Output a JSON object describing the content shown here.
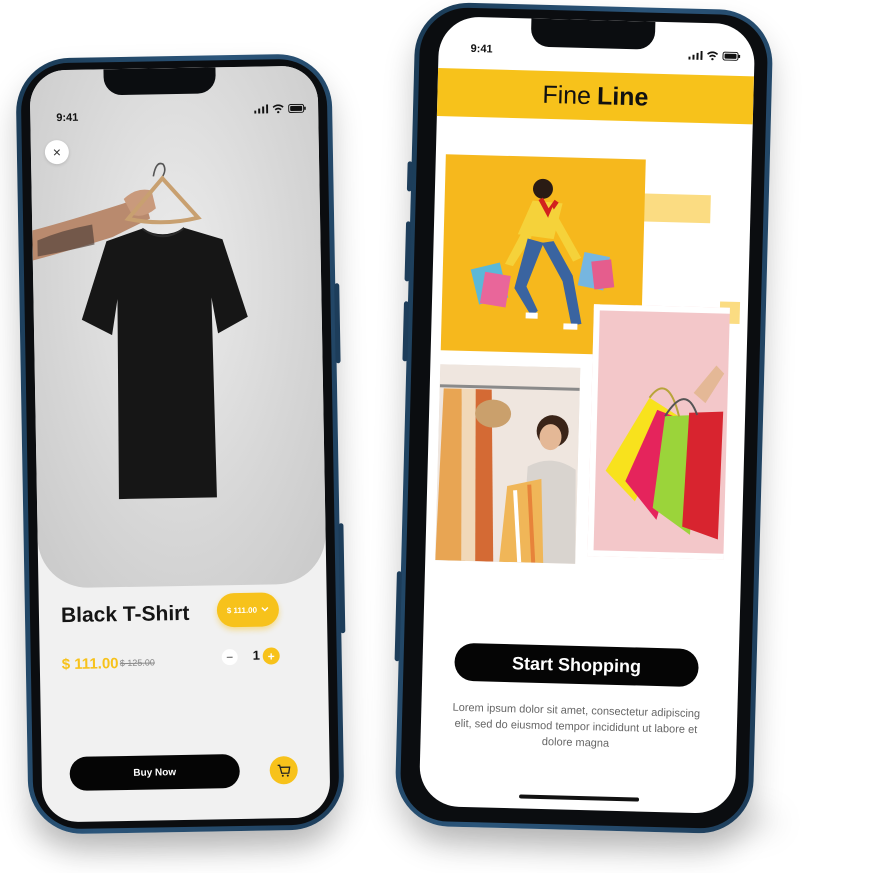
{
  "colors": {
    "accent": "#f7c21b",
    "dark": "#050505",
    "frame": "#1d3d5a"
  },
  "product_screen": {
    "status_time": "9:41",
    "close_icon": "×",
    "title": "Black T-Shirt",
    "size_selector": {
      "label": "$ 111.00",
      "icon": "chevron-down-icon"
    },
    "price": "$ 111.00",
    "old_price": "$ 125.00",
    "quantity": {
      "minus": "−",
      "value": "1",
      "plus": "+"
    },
    "buy_label": "Buy Now",
    "cart_icon": "cart-icon"
  },
  "landing_screen": {
    "status_time": "9:41",
    "brand_light": "Fine",
    "brand_bold": "Line",
    "cta_label": "Start Shopping",
    "description": "Lorem ipsum dolor sit amet, consectetur adipiscing elit, sed do eiusmod tempor incididunt ut labore et dolore magna"
  }
}
